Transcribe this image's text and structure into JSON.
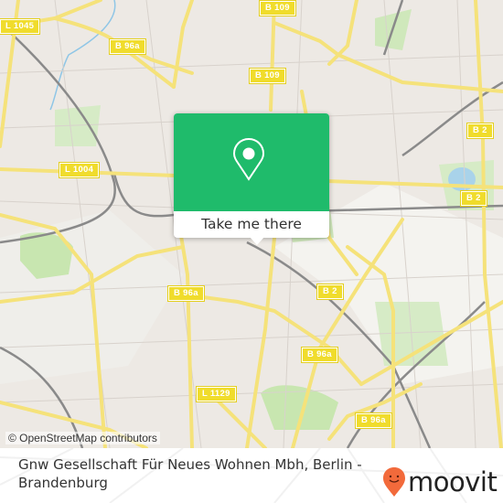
{
  "map": {
    "road_labels": [
      {
        "id": "l1045",
        "text": "L 1045"
      },
      {
        "id": "b96a-top",
        "text": "B 96a"
      },
      {
        "id": "b109-top",
        "text": "B 109"
      },
      {
        "id": "b109-mid",
        "text": "B 109"
      },
      {
        "id": "b2-right1",
        "text": "B 2"
      },
      {
        "id": "b2-right2",
        "text": "B 2"
      },
      {
        "id": "l1004",
        "text": "L 1004"
      },
      {
        "id": "b96a-mid",
        "text": "B 96a"
      },
      {
        "id": "b2-mid",
        "text": "B 2"
      },
      {
        "id": "b96a-lower",
        "text": "B 96a"
      },
      {
        "id": "l1129",
        "text": "L 1129"
      },
      {
        "id": "b96a-bottom",
        "text": "B 96a"
      }
    ],
    "attribution": "© OpenStreetMap contributors",
    "colors": {
      "land": "#ede9e4",
      "park": "#c8e6b0",
      "water": "#a9d3ea",
      "major_road": "#f5e27a",
      "rail": "#8a8a8a"
    }
  },
  "popup": {
    "icon": "map-pin-icon",
    "button_label": "Take me there",
    "color": "#1fbb6b"
  },
  "footer": {
    "place_name": "Gnw Gesellschaft Für Neues Wohnen Mbh, Berlin - Brandenburg",
    "brand": "moovit",
    "brand_color": "#f26a3b"
  }
}
